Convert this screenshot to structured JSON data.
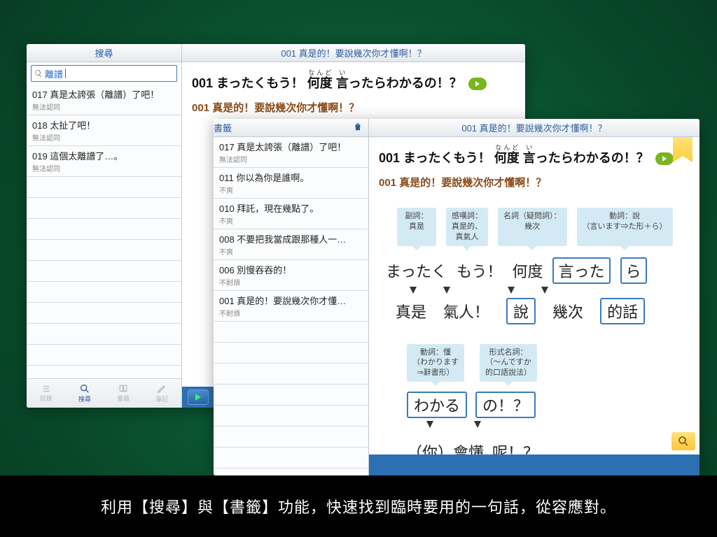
{
  "caption": "利用【搜尋】與【書籤】功能，快速找到臨時要用的一句話，從容應對。",
  "winA": {
    "leftTitle": "搜尋",
    "mainTitle": "001 真是的！要說幾次你才懂啊！？",
    "search": "離譜",
    "list": [
      {
        "ttl": "017 真是太誇張（離譜）了吧！",
        "sub": "無法認同"
      },
      {
        "ttl": "018 太扯了吧！",
        "sub": "無法認同"
      },
      {
        "ttl": "019 這個太離譜了…。",
        "sub": "無法認同"
      }
    ],
    "tabs": [
      {
        "key": "toc",
        "label": "目錄"
      },
      {
        "key": "search",
        "label": "搜尋"
      },
      {
        "key": "bookmark",
        "label": "書籤"
      },
      {
        "key": "notes",
        "label": "筆記"
      }
    ],
    "detail_jp_pre": "001 まったくもう！ ",
    "detail_jp_kanji": "何度",
    "detail_jp_ruby": "なんど",
    "detail_jp_post": "言ったらわかるの！？",
    "detail_zh": "001 真是的！要說幾次你才懂啊！？"
  },
  "winB": {
    "leftTitle": "書籤",
    "mainTitle": "001 真是的！要說幾次你才懂啊！？",
    "list": [
      {
        "ttl": "017 真是太誇張（離譜）了吧！",
        "sub": "無法認同"
      },
      {
        "ttl": "011 你以為你是誰啊。",
        "sub": "不爽"
      },
      {
        "ttl": "010 拜託，現在幾點了。",
        "sub": "不爽"
      },
      {
        "ttl": "008 不要把我當成跟那種人一…",
        "sub": "不爽"
      },
      {
        "ttl": "006 別慢吞吞的！",
        "sub": "不耐煩"
      },
      {
        "ttl": "001 真是的！要說幾次你才懂…",
        "sub": "不耐煩"
      }
    ],
    "detail_jp_pre": "001 まったくもう！ ",
    "detail_jp_kanji": "何度",
    "detail_jp_ruby": "なんど",
    "detail_jp_post": "言ったらわかるの！？",
    "detail_zh": "001 真是的！要說幾次你才懂啊！？",
    "bubbles1": [
      "副詞：\n真是",
      "感嘆詞：\n真是的、\n真氣人",
      "名詞（疑問詞）：\n幾次",
      "動詞：說\n（言います⇒た形＋ら）"
    ],
    "words1": [
      "まったく",
      "もう！",
      "何度"
    ],
    "words1_box": [
      "言った",
      "ら"
    ],
    "words2": [
      "真是",
      "氣人！"
    ],
    "words2_box": [
      "說",
      "幾次",
      "的話"
    ],
    "bubbles2": [
      "動詞：懂\n（わかります\n⇒辭書形）",
      "形式名詞：\n（～んですか\n的口語說法）"
    ],
    "words3_box": [
      "わかる",
      "の！？"
    ],
    "words4": [
      "（你）會懂",
      "呢！？"
    ]
  }
}
